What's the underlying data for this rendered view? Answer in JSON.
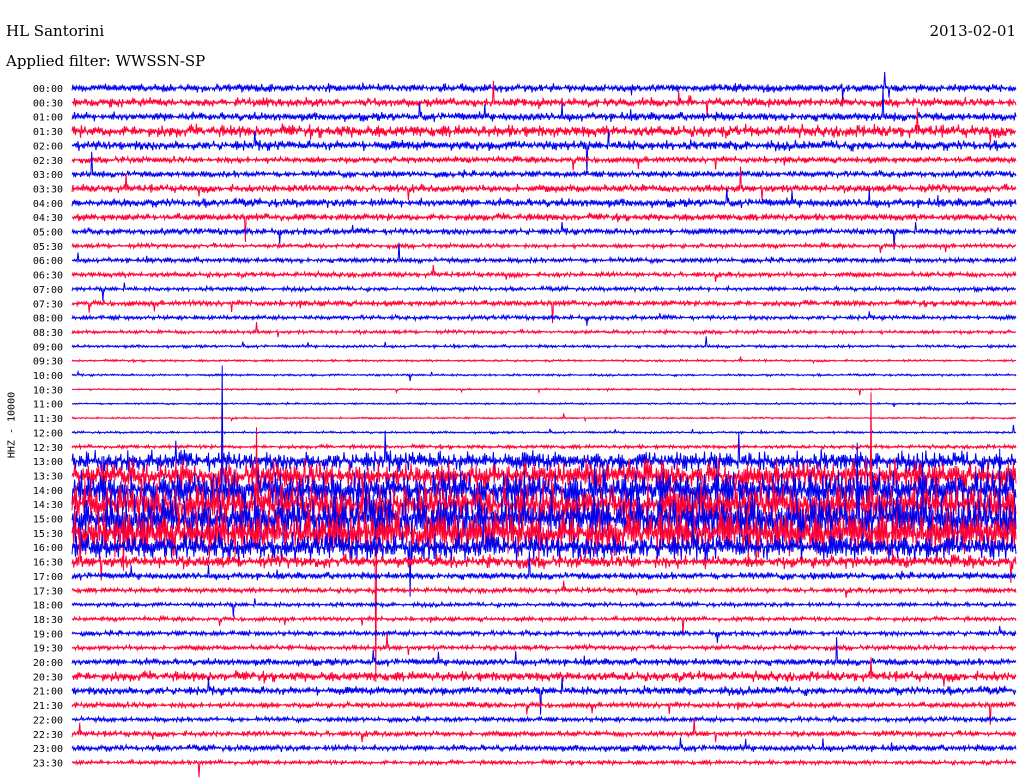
{
  "header": {
    "station": "HL Santorini",
    "date": "2013-02-01",
    "filter": "Applied filter: WWSSN-SP"
  },
  "chart_data": {
    "type": "line",
    "title": "HL Santorini",
    "date": "2013-02-01",
    "filter": "WWSSN-SP",
    "ylabel": "HHZ - 10000",
    "trace_colors": [
      "#0000ee",
      "#ff0033"
    ],
    "tick_labels": [
      "00:00",
      "00:30",
      "01:00",
      "01:30",
      "02:00",
      "02:30",
      "03:00",
      "03:30",
      "04:00",
      "04:30",
      "05:00",
      "05:30",
      "06:00",
      "06:30",
      "07:00",
      "07:30",
      "08:00",
      "08:30",
      "09:00",
      "09:30",
      "10:00",
      "10:30",
      "11:00",
      "11:30",
      "12:00",
      "12:30",
      "13:00",
      "13:30",
      "14:00",
      "14:30",
      "15:00",
      "15:30",
      "16:00",
      "16:30",
      "17:00",
      "17:30",
      "18:00",
      "18:30",
      "19:00",
      "19:30",
      "20:00",
      "20:30",
      "21:00",
      "21:30",
      "22:00",
      "22:30",
      "23:00",
      "23:30"
    ],
    "amplitude_level": [
      0.55,
      0.6,
      0.6,
      0.85,
      0.7,
      0.45,
      0.45,
      0.55,
      0.6,
      0.5,
      0.45,
      0.3,
      0.35,
      0.35,
      0.3,
      0.4,
      0.3,
      0.25,
      0.2,
      0.15,
      0.15,
      0.12,
      0.12,
      0.12,
      0.15,
      0.25,
      1.4,
      2.0,
      2.5,
      2.8,
      3.2,
      3.0,
      1.8,
      0.9,
      0.5,
      0.35,
      0.3,
      0.3,
      0.35,
      0.35,
      0.5,
      0.7,
      0.6,
      0.4,
      0.35,
      0.4,
      0.45,
      0.3
    ]
  }
}
